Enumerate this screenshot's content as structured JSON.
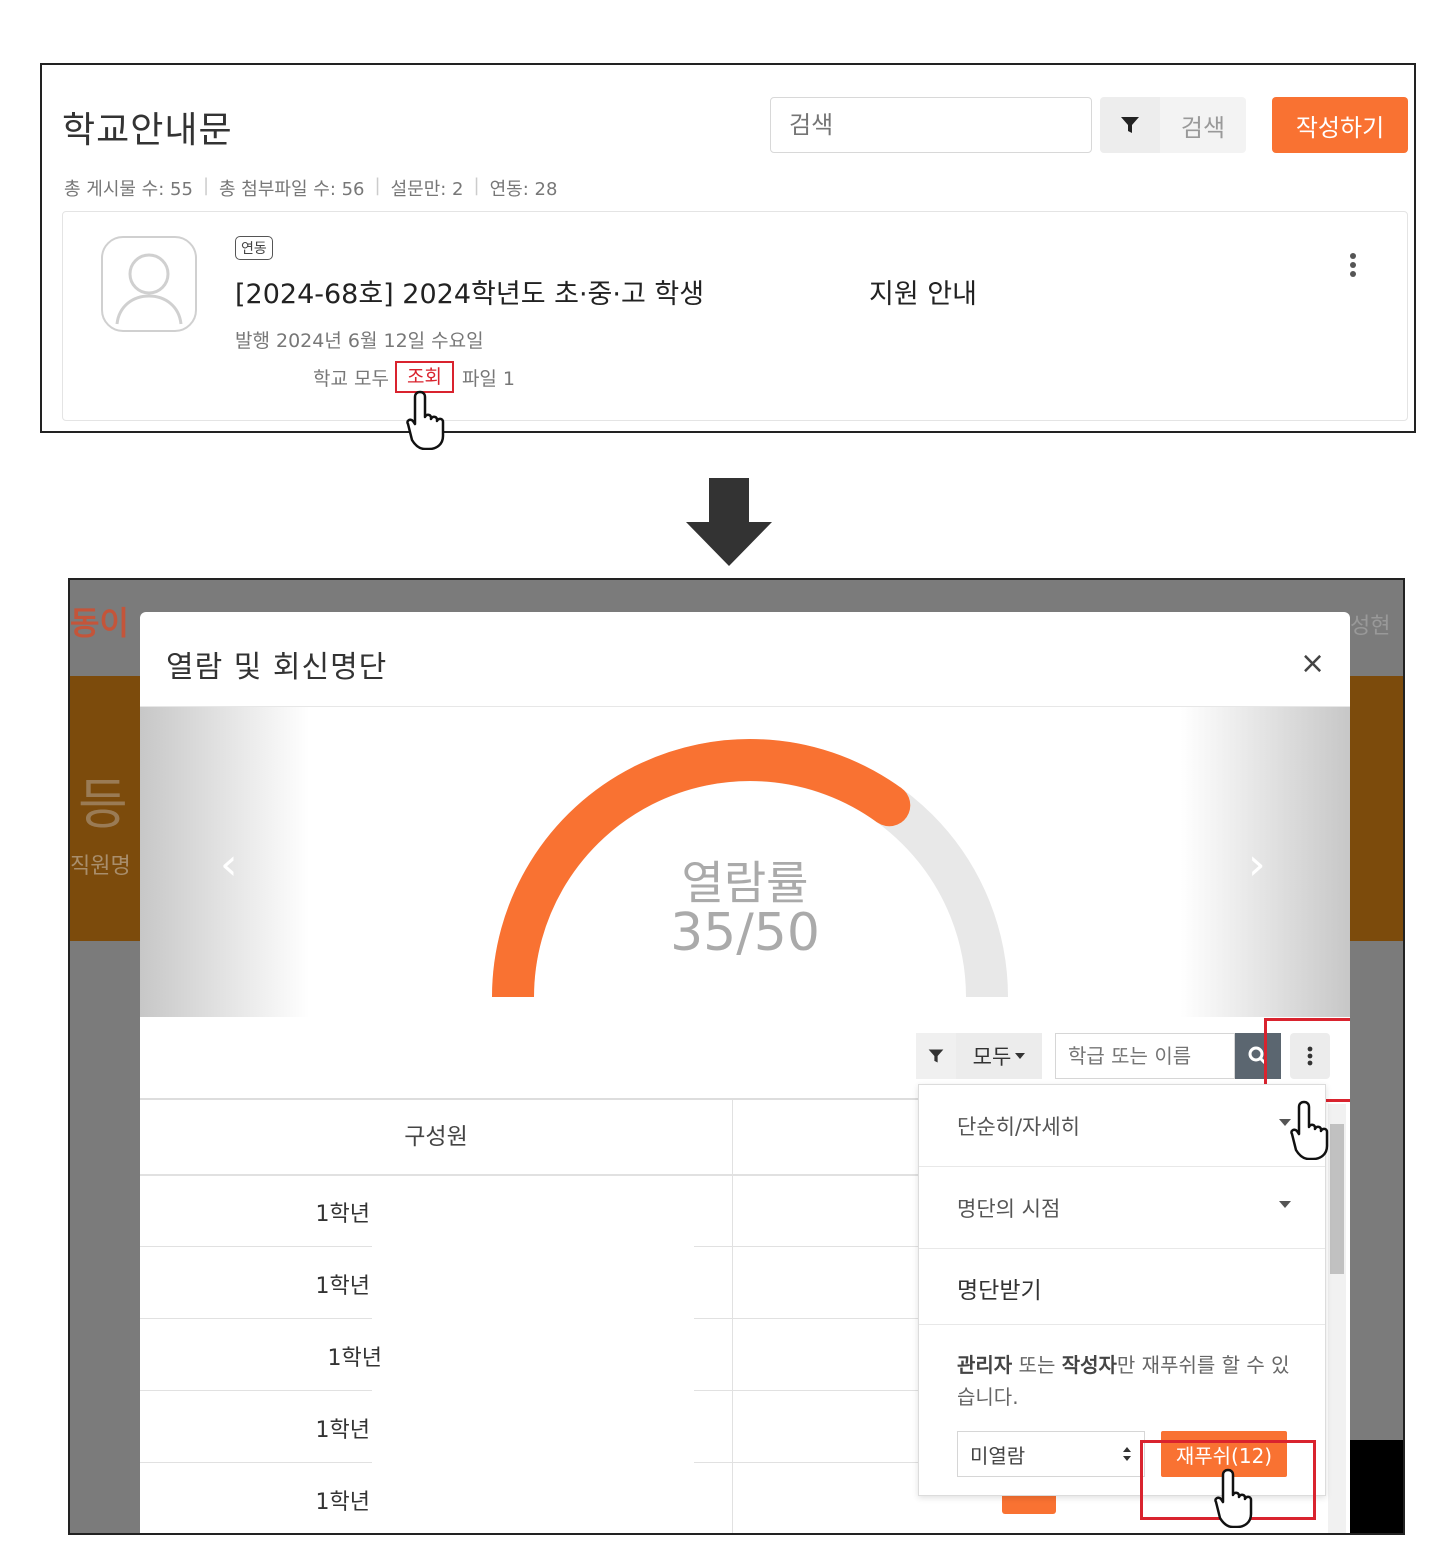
{
  "board": {
    "title": "학교안내문",
    "search_placeholder": "검색",
    "search_button": "검색",
    "write_button": "작성하기",
    "stats": [
      "총 게시물 수: 55",
      "총 첨부파일 수: 56",
      "설문만: 2",
      "연동: 28"
    ],
    "post": {
      "tag": "연동",
      "title": "[2024-68호] 2024학년도 초·중·고 학생",
      "title_tail": "지원 안내",
      "date": "발행 2024년 6월 12일 수요일",
      "meta_prefix": "학교 모두",
      "view_link": "조회",
      "files": "파일 1"
    }
  },
  "background": {
    "logo_text": "동이",
    "big_text": "등",
    "sub_text": "직원명",
    "right_text": "성현"
  },
  "modal": {
    "title": "열람 및 회신명단",
    "close": "×",
    "gauge": {
      "label": "열람률",
      "value_text": "35/50",
      "viewed": 35,
      "total": 50
    },
    "prev": "‹",
    "next": "›",
    "filter_select": "모두",
    "member_search_placeholder": "학급 또는 이름",
    "column_header": "구성원",
    "rows": [
      "1학년",
      "1학년",
      "1학년",
      "1학년",
      "1학년"
    ]
  },
  "dropdown": {
    "simple_detail": "단순히/자세히",
    "list_time": "명단의 시점",
    "download": "명단받기",
    "notice_bold1": "관리자",
    "notice_mid": " 또는 ",
    "notice_bold2": "작성자",
    "notice_rest": "만 재푸쉬를 할 수 있습니다.",
    "status_select": "미열람",
    "repush_button": "재푸쉬(12)"
  },
  "colors": {
    "accent": "#f97232",
    "highlight": "#d9232e"
  }
}
